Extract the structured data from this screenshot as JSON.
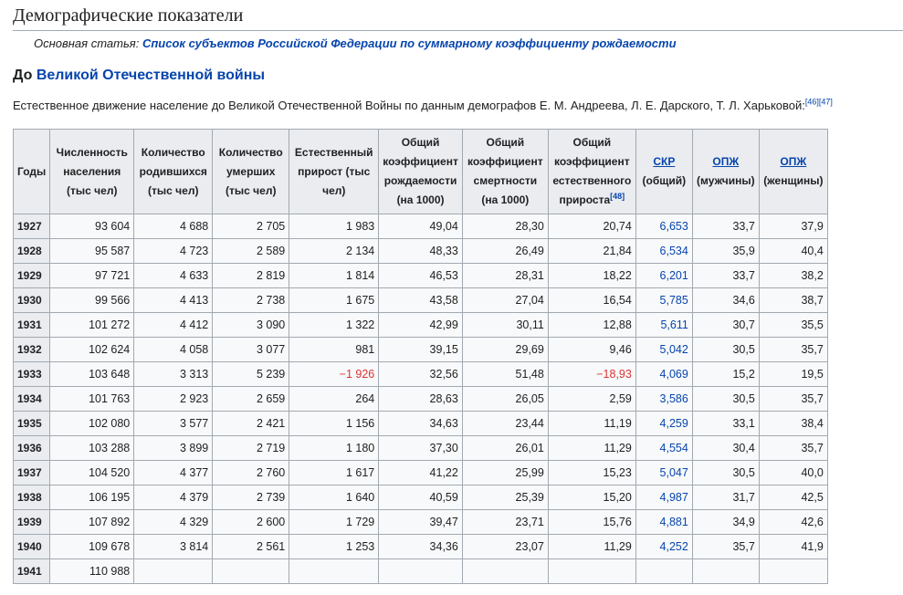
{
  "section_title": "Демографические показатели",
  "hatnote": {
    "prefix": "Основная статья: ",
    "link": "Список субъектов Российской Федерации по суммарному коэффициенту рождаемости"
  },
  "subsection": {
    "prefix": "До ",
    "link": "Великой Отечественной войны"
  },
  "paragraph": {
    "text": "Естественное движение население до Великой Отечественной Войны по данным демографов Е. М. Андреева, Л. Е. Дарского, Т. Л. Харьковой:",
    "refs": "[46][47]"
  },
  "table": {
    "headers": {
      "year": "Годы",
      "population": "Численность населения (тыс чел)",
      "births": "Количество родившихся (тыс чел)",
      "deaths": "Количество умерших (тыс чел)",
      "growth": "Естественный прирост (тыс чел)",
      "cbr": "Общий коэффициент рождаемости (на 1000)",
      "cdr": "Общий коэффициент смертности (на 1000)",
      "cngr": "Общий коэффициент естественного прироста",
      "cngr_ref": "[48]",
      "tfr_link": "СКР",
      "tfr_suffix": "(общий)",
      "le_m_link": "ОПЖ",
      "le_m_suffix": "(мужчины)",
      "le_f_link": "ОПЖ",
      "le_f_suffix": "(женщины)"
    },
    "rows": [
      {
        "year": "1927",
        "population": "93 604",
        "births": "4 688",
        "deaths": "2 705",
        "growth": "1 983",
        "cbr": "49,04",
        "cdr": "28,30",
        "cngr": "20,74",
        "tfr": "6,653",
        "le_m": "33,7",
        "le_f": "37,9"
      },
      {
        "year": "1928",
        "population": "95 587",
        "births": "4 723",
        "deaths": "2 589",
        "growth": "2 134",
        "cbr": "48,33",
        "cdr": "26,49",
        "cngr": "21,84",
        "tfr": "6,534",
        "le_m": "35,9",
        "le_f": "40,4"
      },
      {
        "year": "1929",
        "population": "97 721",
        "births": "4 633",
        "deaths": "2 819",
        "growth": "1 814",
        "cbr": "46,53",
        "cdr": "28,31",
        "cngr": "18,22",
        "tfr": "6,201",
        "le_m": "33,7",
        "le_f": "38,2"
      },
      {
        "year": "1930",
        "population": "99 566",
        "births": "4 413",
        "deaths": "2 738",
        "growth": "1 675",
        "cbr": "43,58",
        "cdr": "27,04",
        "cngr": "16,54",
        "tfr": "5,785",
        "le_m": "34,6",
        "le_f": "38,7"
      },
      {
        "year": "1931",
        "population": "101 272",
        "births": "4 412",
        "deaths": "3 090",
        "growth": "1 322",
        "cbr": "42,99",
        "cdr": "30,11",
        "cngr": "12,88",
        "tfr": "5,611",
        "le_m": "30,7",
        "le_f": "35,5"
      },
      {
        "year": "1932",
        "population": "102 624",
        "births": "4 058",
        "deaths": "3 077",
        "growth": "981",
        "cbr": "39,15",
        "cdr": "29,69",
        "cngr": "9,46",
        "tfr": "5,042",
        "le_m": "30,5",
        "le_f": "35,7"
      },
      {
        "year": "1933",
        "population": "103 648",
        "births": "3 313",
        "deaths": "5 239",
        "growth": "−1 926",
        "cbr": "32,56",
        "cdr": "51,48",
        "cngr": "−18,93",
        "tfr": "4,069",
        "le_m": "15,2",
        "le_f": "19,5"
      },
      {
        "year": "1934",
        "population": "101 763",
        "births": "2 923",
        "deaths": "2 659",
        "growth": "264",
        "cbr": "28,63",
        "cdr": "26,05",
        "cngr": "2,59",
        "tfr": "3,586",
        "le_m": "30,5",
        "le_f": "35,7"
      },
      {
        "year": "1935",
        "population": "102 080",
        "births": "3 577",
        "deaths": "2 421",
        "growth": "1 156",
        "cbr": "34,63",
        "cdr": "23,44",
        "cngr": "11,19",
        "tfr": "4,259",
        "le_m": "33,1",
        "le_f": "38,4"
      },
      {
        "year": "1936",
        "population": "103 288",
        "births": "3 899",
        "deaths": "2 719",
        "growth": "1 180",
        "cbr": "37,30",
        "cdr": "26,01",
        "cngr": "11,29",
        "tfr": "4,554",
        "le_m": "30,4",
        "le_f": "35,7"
      },
      {
        "year": "1937",
        "population": "104 520",
        "births": "4 377",
        "deaths": "2 760",
        "growth": "1 617",
        "cbr": "41,22",
        "cdr": "25,99",
        "cngr": "15,23",
        "tfr": "5,047",
        "le_m": "30,5",
        "le_f": "40,0"
      },
      {
        "year": "1938",
        "population": "106 195",
        "births": "4 379",
        "deaths": "2 739",
        "growth": "1 640",
        "cbr": "40,59",
        "cdr": "25,39",
        "cngr": "15,20",
        "tfr": "4,987",
        "le_m": "31,7",
        "le_f": "42,5"
      },
      {
        "year": "1939",
        "population": "107 892",
        "births": "4 329",
        "deaths": "2 600",
        "growth": "1 729",
        "cbr": "39,47",
        "cdr": "23,71",
        "cngr": "15,76",
        "tfr": "4,881",
        "le_m": "34,9",
        "le_f": "42,6"
      },
      {
        "year": "1940",
        "population": "109 678",
        "births": "3 814",
        "deaths": "2 561",
        "growth": "1 253",
        "cbr": "34,36",
        "cdr": "23,07",
        "cngr": "11,29",
        "tfr": "4,252",
        "le_m": "35,7",
        "le_f": "41,9"
      },
      {
        "year": "1941",
        "population": "110 988",
        "births": "",
        "deaths": "",
        "growth": "",
        "cbr": "",
        "cdr": "",
        "cngr": "",
        "tfr": "",
        "le_m": "",
        "le_f": ""
      }
    ]
  }
}
